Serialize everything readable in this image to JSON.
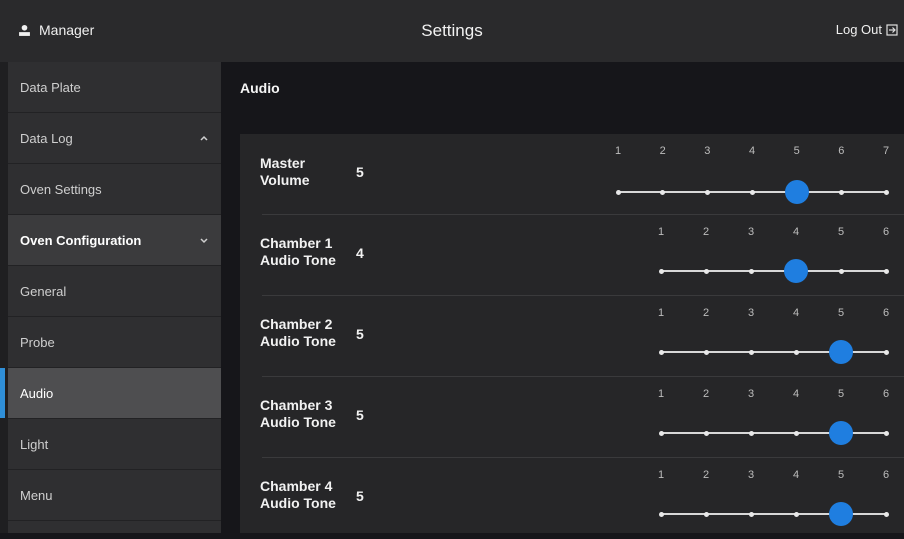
{
  "header": {
    "user_label": "Manager",
    "title": "Settings",
    "logout_label": "Log Out"
  },
  "sidebar": {
    "items": [
      {
        "label": "Data Plate",
        "kind": "parent-closed"
      },
      {
        "label": "Data Log",
        "kind": "parent-open",
        "chevron": "chevron-up"
      },
      {
        "label": "Oven Settings",
        "kind": "child"
      },
      {
        "label": "Oven Configuration",
        "kind": "parent",
        "chevron": "chevron-down"
      },
      {
        "label": "General",
        "kind": "child"
      },
      {
        "label": "Probe",
        "kind": "child"
      },
      {
        "label": "Audio",
        "kind": "child",
        "active": true
      },
      {
        "label": "Light",
        "kind": "child"
      },
      {
        "label": "Menu",
        "kind": "child"
      }
    ]
  },
  "main": {
    "section_title": "Audio",
    "rows": [
      {
        "label_line1": "Master",
        "label_line2": "Volume",
        "value": "5",
        "ticks": [
          "1",
          "2",
          "3",
          "4",
          "5",
          "6",
          "7"
        ],
        "selected": 5
      },
      {
        "label_line1": "Chamber 1",
        "label_line2": "Audio Tone",
        "value": "4",
        "ticks": [
          "1",
          "2",
          "3",
          "4",
          "5",
          "6"
        ],
        "selected": 4
      },
      {
        "label_line1": "Chamber 2",
        "label_line2": "Audio Tone",
        "value": "5",
        "ticks": [
          "1",
          "2",
          "3",
          "4",
          "5",
          "6"
        ],
        "selected": 5
      },
      {
        "label_line1": "Chamber 3",
        "label_line2": "Audio Tone",
        "value": "5",
        "ticks": [
          "1",
          "2",
          "3",
          "4",
          "5",
          "6"
        ],
        "selected": 5
      },
      {
        "label_line1": "Chamber 4",
        "label_line2": "Audio Tone",
        "value": "5",
        "ticks": [
          "1",
          "2",
          "3",
          "4",
          "5",
          "6"
        ],
        "selected": 5
      }
    ]
  },
  "colors": {
    "accent": "#1f7ee0",
    "active_marker": "#2f8fd8"
  }
}
